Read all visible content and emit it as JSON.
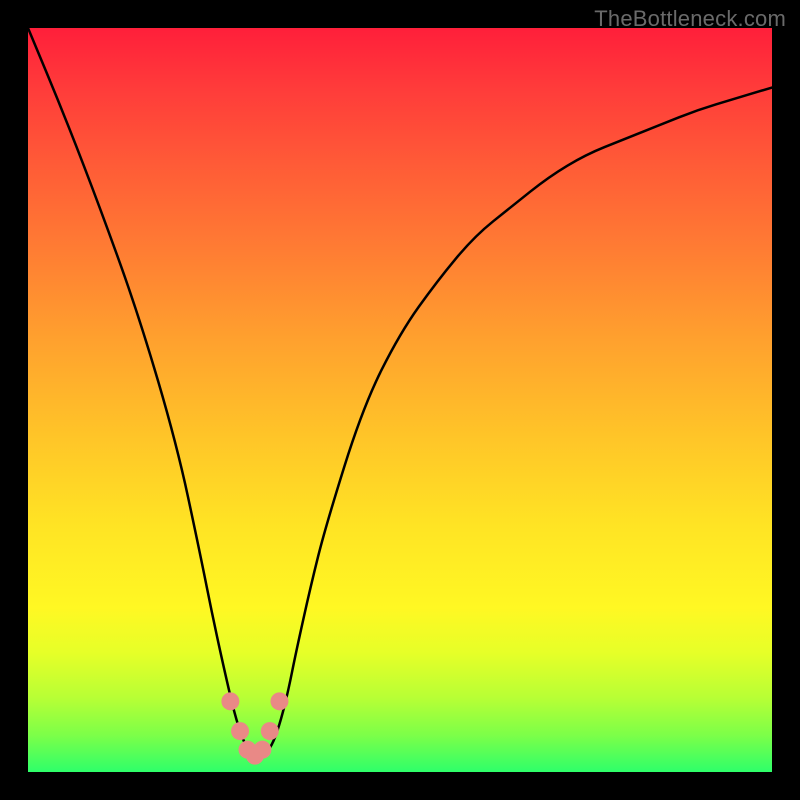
{
  "watermark": "TheBottleneck.com",
  "chart_data": {
    "type": "line",
    "title": "",
    "xlabel": "",
    "ylabel": "",
    "xlim": [
      0,
      100
    ],
    "ylim": [
      0,
      100
    ],
    "series": [
      {
        "name": "bottleneck-curve",
        "x": [
          0,
          5,
          10,
          15,
          20,
          23,
          25,
          27,
          28,
          29,
          30,
          31,
          32,
          33,
          34,
          35,
          36,
          38,
          40,
          45,
          50,
          55,
          60,
          65,
          70,
          75,
          80,
          85,
          90,
          95,
          100
        ],
        "values": [
          100,
          88,
          75,
          61,
          44,
          30,
          20,
          11,
          7,
          4,
          2.5,
          2,
          2.5,
          4,
          7,
          11,
          16,
          25,
          33,
          49,
          59,
          66,
          72,
          76,
          80,
          83,
          85,
          87,
          89,
          90.5,
          92
        ]
      }
    ],
    "markers": {
      "name": "highlight-points",
      "x": [
        27.2,
        28.5,
        29.5,
        30.5,
        31.5,
        32.5,
        33.8
      ],
      "values": [
        9.5,
        5.5,
        3.0,
        2.2,
        3.0,
        5.5,
        9.5
      ]
    },
    "gradient_stops": [
      {
        "offset": 0,
        "color": "#ff1f3a"
      },
      {
        "offset": 8,
        "color": "#ff3b3a"
      },
      {
        "offset": 18,
        "color": "#ff5a37"
      },
      {
        "offset": 30,
        "color": "#ff7d33"
      },
      {
        "offset": 42,
        "color": "#ffa12e"
      },
      {
        "offset": 55,
        "color": "#ffc528"
      },
      {
        "offset": 67,
        "color": "#ffe424"
      },
      {
        "offset": 78,
        "color": "#fff823"
      },
      {
        "offset": 84,
        "color": "#e6ff28"
      },
      {
        "offset": 90,
        "color": "#b8ff35"
      },
      {
        "offset": 95,
        "color": "#7dff48"
      },
      {
        "offset": 100,
        "color": "#2eff6a"
      }
    ]
  }
}
